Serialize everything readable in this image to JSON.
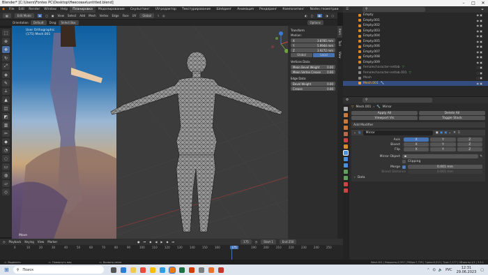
{
  "window": {
    "title": "Blender* [C:\\Users\\Fontes PC\\Desktop\\Нвесовая\\untitled.blend]"
  },
  "menu": {
    "items": [
      "File",
      "Edit",
      "Render",
      "Window",
      "Help"
    ]
  },
  "workspaces": [
    "Планировка",
    "Моделирование",
    "Скульптинг",
    "UV-редактор",
    "Текстурирование",
    "Шейдинг",
    "Анимация",
    "Рендеринг",
    "Композитинг",
    "Nodes геометрии",
    "Скриптинг"
  ],
  "active_workspace": "Планировка",
  "header_right": {
    "scene": "Scene",
    "viewlayer": "ViewLayer"
  },
  "viewport_header": {
    "mode": "Edit Mode",
    "view": "View",
    "select": "Select",
    "add": "Add",
    "mesh": "Mesh",
    "vertex": "Vertex",
    "edge": "Edge",
    "face": "Face",
    "uv": "UV",
    "transform": "Global"
  },
  "tool_header": {
    "orientation_label": "Orientation:",
    "orientation": "Default",
    "drag_label": "Drag:",
    "drag": "Select Box",
    "options": "Options"
  },
  "viewport_overlay": {
    "line1": "User Orthographic",
    "line2": "(175) Mesh.001",
    "status": "Move"
  },
  "npanel": {
    "transform_title": "Transform",
    "median_label": "Median:",
    "x_label": "X",
    "x_value": "3.8785 mm",
    "y_label": "Y",
    "y_value": "5.9944 mm",
    "z_label": "Z",
    "z_value": "3.9272 mm",
    "global_label": "Global",
    "local_label": "Local",
    "vertices_title": "Vertices Data:",
    "mean_bevel_weight_label": "Mean Bevel Weight",
    "mean_bevel_weight": "0.00",
    "mean_vertex_crease_label": "Mean Vertex Crease",
    "mean_vertex_crease": "0.00",
    "edges_title": "Edge Data:",
    "bevel_weight_label": "Bevel Weight",
    "bevel_weight": "0.00",
    "crease_label": "Crease",
    "crease": "0.00"
  },
  "vtabs": [
    "Item",
    "Tool",
    "View"
  ],
  "outliner": {
    "items": [
      "Empty",
      "Empty.001",
      "Empty.002",
      "Empty.003",
      "Empty.004",
      "Empty.005",
      "Empty.006",
      "Empty.007",
      "Empty.008",
      "Empty.009",
      "femalecharacter-netlab",
      "femalecharacter-netlab.001",
      "Mesh",
      "Mesh.001"
    ]
  },
  "properties": {
    "breadcrumb_obj": "Mesh.001",
    "breadcrumb_mod": "Mirror",
    "apply_all": "Apply All",
    "delete_all": "Delete All",
    "viewport_vis": "Viewport Vis",
    "toggle_stack": "Toggle Stack",
    "add_modifier": "Add Modifier",
    "modifier_name": "Mirror",
    "axis_label": "Axis",
    "bisect_label": "Bisect",
    "flip_label": "Flip",
    "x": "X",
    "y": "Y",
    "z": "Z",
    "mirror_object_label": "Mirror Object",
    "clipping_label": "Clipping",
    "merge_label": "Merge",
    "merge_value": "0.001 mm",
    "bisect_distance_label": "Bisect Distance",
    "bisect_distance_value": "0.001 mm",
    "data_label": "Data"
  },
  "timeline": {
    "playback": "Playback",
    "keying": "Keying",
    "view": "View",
    "marker": "Marker",
    "current_frame": "175",
    "start_label": "Start",
    "start": "1",
    "end_label": "End",
    "end": "250",
    "ticks": [
      "0",
      "10",
      "20",
      "30",
      "40",
      "50",
      "60",
      "70",
      "80",
      "90",
      "100",
      "110",
      "120",
      "130",
      "140",
      "150",
      "160",
      "175",
      "190",
      "200",
      "210",
      "220",
      "230",
      "240",
      "250"
    ]
  },
  "statusbar": {
    "select": "Выделить",
    "rotate": "Повернуть вид",
    "call_menu": "Вызвать меню",
    "stats": "Mesh.001 | Вершины:2,597 | Рёбра:7,729 | Грани:5,013 | Трис:7,177 | Объекты:1/1 | 3.5.1"
  },
  "taskbar": {
    "search_placeholder": "Поиск",
    "lang": "РУС",
    "time": "12:31",
    "date": "29.06.2023"
  },
  "colors": {
    "accent": "#4772b3",
    "orange": "#d98b2c"
  }
}
